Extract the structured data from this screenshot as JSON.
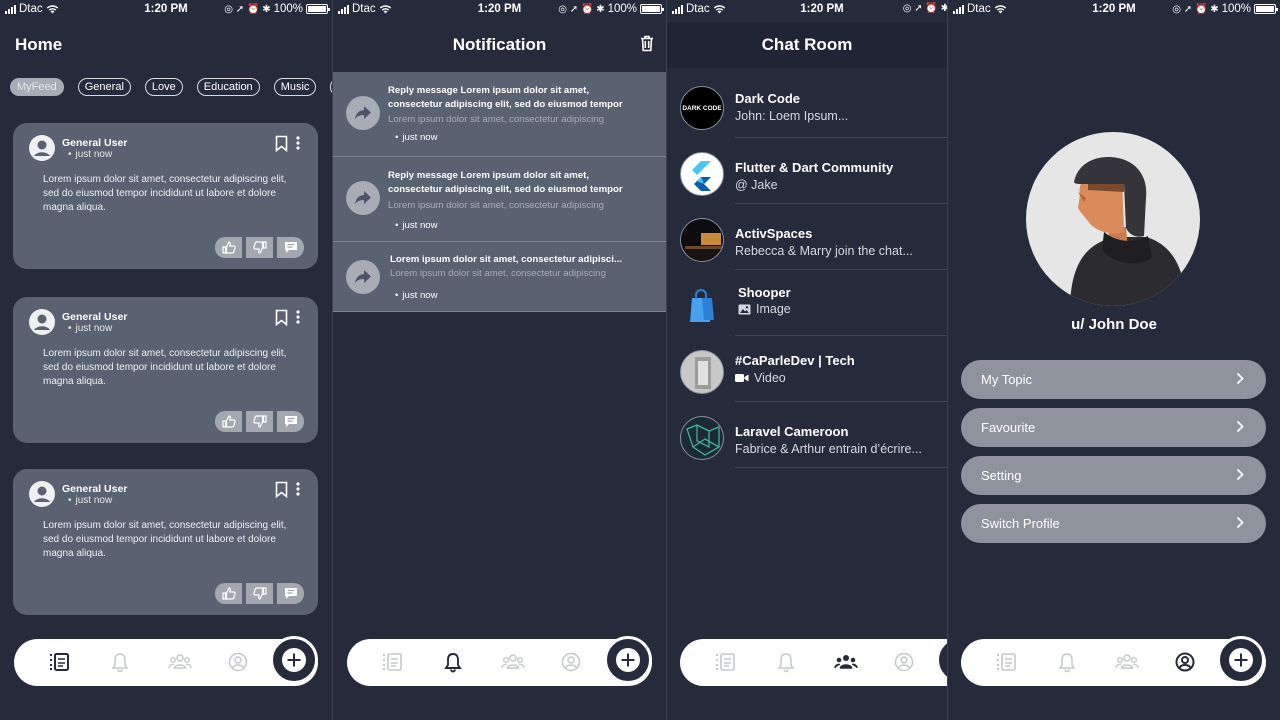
{
  "status_bar": {
    "carrier": "Dtac",
    "time": "1:20 PM",
    "battery": "100%",
    "battery_level": 1.0
  },
  "home": {
    "title": "Home",
    "chips": [
      "MyFeed",
      "General",
      "Love",
      "Education",
      "Music"
    ],
    "active_chip": "MyFeed",
    "posts": [
      {
        "user": "General User",
        "time": "just now",
        "body": "Lorem ipsum dolor sit amet, consectetur adipiscing elit, sed do eiusmod tempor incididunt ut labore et dolore magna aliqua."
      },
      {
        "user": "General User",
        "time": "just now",
        "body": "Lorem ipsum dolor sit amet, consectetur adipiscing elit, sed do eiusmod tempor incididunt ut labore et dolore magna aliqua."
      },
      {
        "user": "General User",
        "time": "just now",
        "body": "Lorem ipsum dolor sit amet, consectetur adipiscing elit, sed do eiusmod tempor incididunt ut labore et dolore magna aliqua."
      }
    ]
  },
  "notification": {
    "title": "Notification",
    "items": [
      {
        "title": "Reply message Lorem ipsum dolor sit amet, consectetur adipiscing elit, sed do eiusmod tempor incid...",
        "sub": "Lorem ipsum dolor sit amet, consectetur adipiscing",
        "time": "just now"
      },
      {
        "title": "Reply message Lorem ipsum dolor sit amet, consectetur adipiscing elit, sed do eiusmod tempor incid...",
        "sub": "Lorem ipsum dolor sit amet, consectetur adipiscing",
        "time": "just now"
      },
      {
        "title": "Lorem ipsum dolor sit amet, consectetur adipisci...",
        "sub": "Lorem ipsum dolor sit amet, consectetur adipiscing",
        "time": "just now"
      }
    ]
  },
  "chat_room": {
    "title": "Chat Room",
    "chats": [
      {
        "name": "Dark Code",
        "message": "John:  Loem Ipsum...",
        "avatar_text": "DARK CODE"
      },
      {
        "name": "Flutter & Dart Community",
        "message": "@ Jake"
      },
      {
        "name": "ActivSpaces",
        "message": "Rebecca & Marry join the chat..."
      },
      {
        "name": "Shooper",
        "message": "Image",
        "message_icon": "image-icon"
      },
      {
        "name": "#CaParleDev | Tech",
        "message": "Video",
        "message_icon": "video-icon"
      },
      {
        "name": "Laravel Cameroon",
        "message": "Fabrice & Arthur entrain d’écrire..."
      }
    ]
  },
  "profile": {
    "username": "u/ John Doe",
    "menu": [
      "My Topic",
      "Favourite",
      "Setting",
      "Switch Profile"
    ]
  },
  "colors": {
    "background": "#252b3b",
    "card": "#5a6170",
    "button": "#8f939d",
    "nav": "#ffffff"
  }
}
